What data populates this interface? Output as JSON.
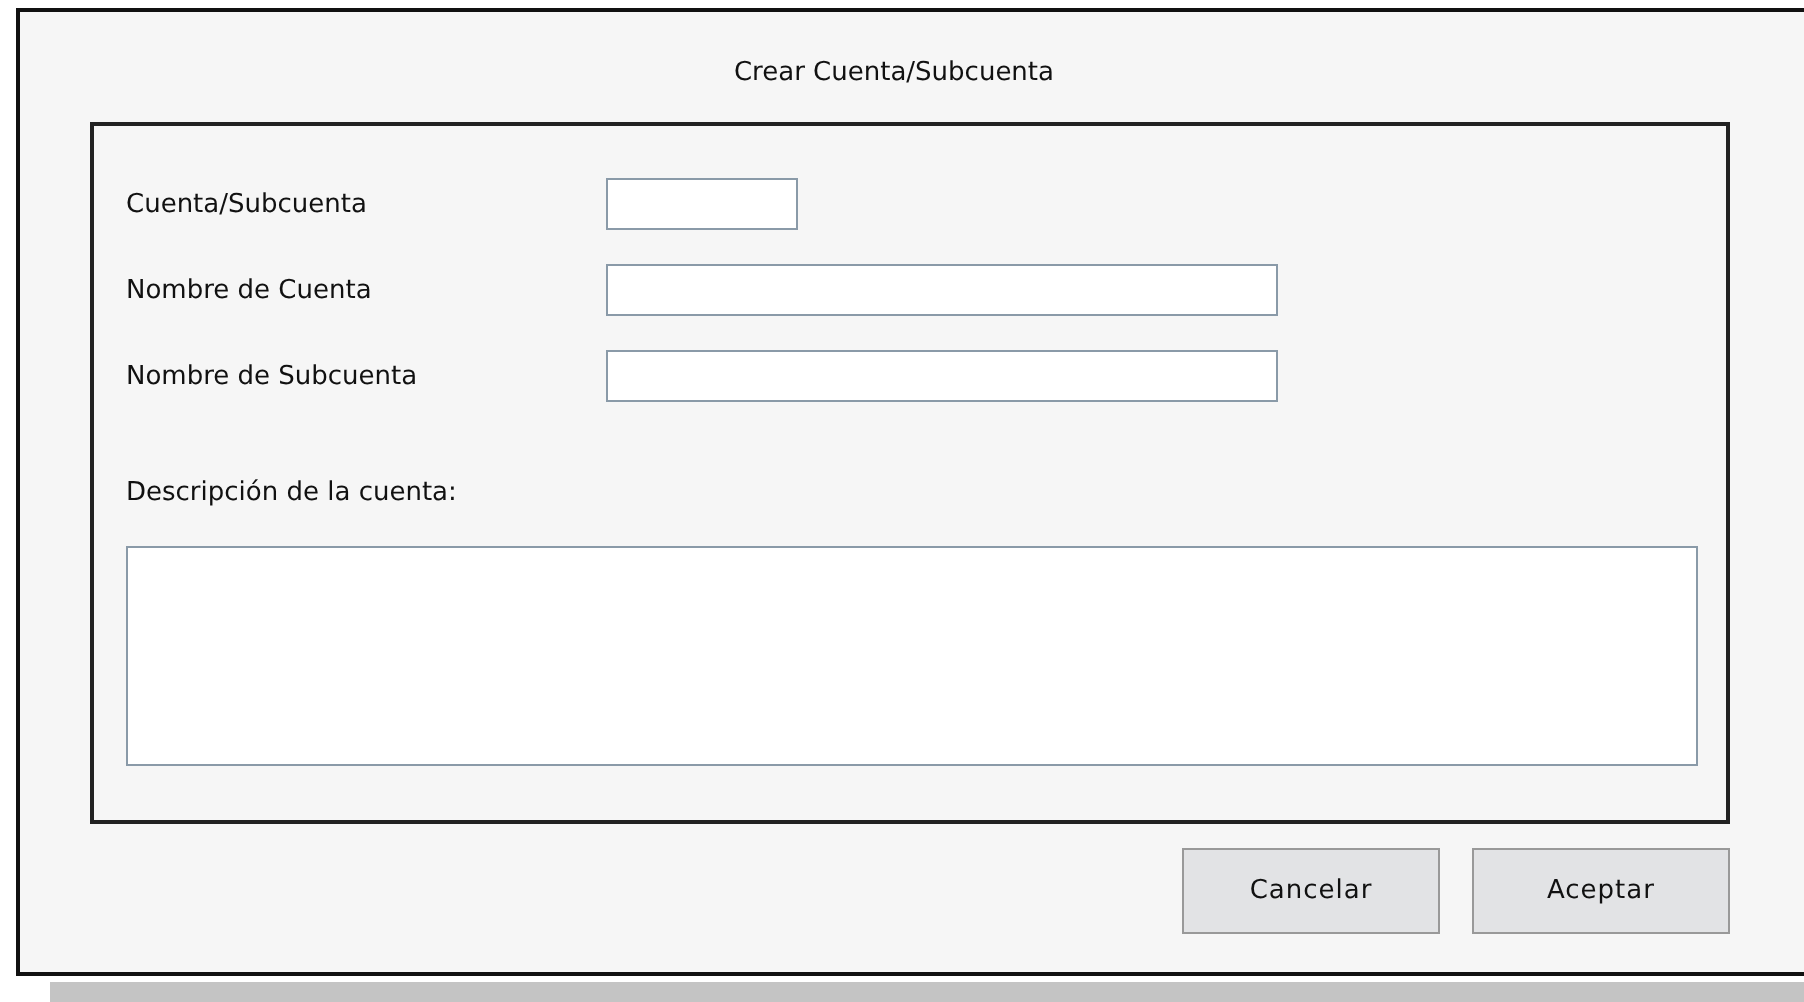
{
  "window": {
    "title": "Crear Cuenta/Subcuenta"
  },
  "fields": [
    {
      "label": "Cuenta/Subcuenta",
      "kind": "short"
    },
    {
      "label": "Nombre de Cuenta",
      "kind": "long"
    },
    {
      "label": "Nombre de Subcuenta",
      "kind": "long"
    }
  ],
  "description": {
    "label": "Descripción de la cuenta:"
  },
  "buttons": [
    "Cancelar",
    "Aceptar"
  ]
}
